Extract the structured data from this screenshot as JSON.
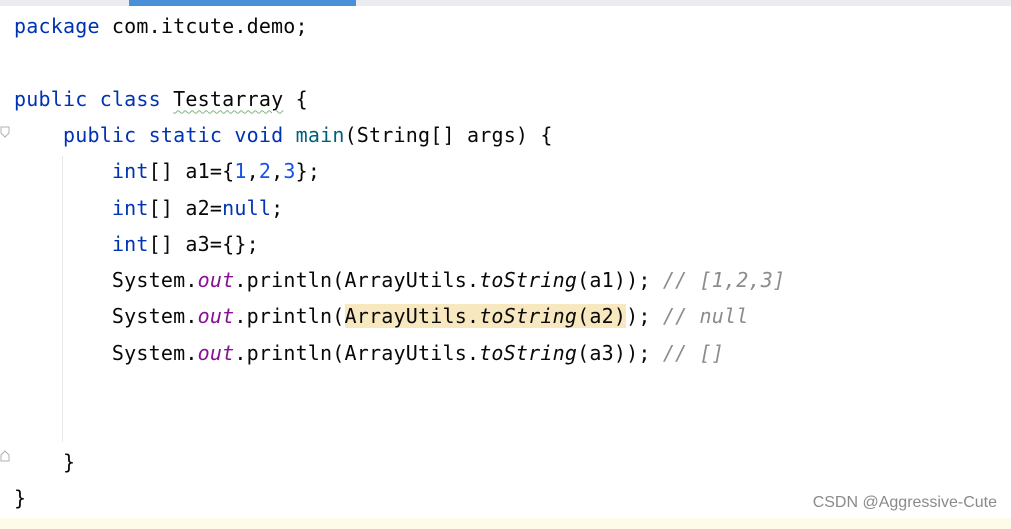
{
  "editor": {
    "lines": [
      {
        "tokens": [
          {
            "t": "package",
            "c": "kw"
          },
          {
            "t": " com.itcute.demo;",
            "c": ""
          }
        ]
      },
      {
        "tokens": []
      },
      {
        "tokens": [
          {
            "t": "public",
            "c": "kw"
          },
          {
            "t": " ",
            "c": ""
          },
          {
            "t": "class",
            "c": "kw"
          },
          {
            "t": " ",
            "c": ""
          },
          {
            "t": "Testarray",
            "c": "typo"
          },
          {
            "t": " {",
            "c": ""
          }
        ]
      },
      {
        "tokens": [
          {
            "t": "    ",
            "c": ""
          },
          {
            "t": "public",
            "c": "kw"
          },
          {
            "t": " ",
            "c": ""
          },
          {
            "t": "static",
            "c": "kw"
          },
          {
            "t": " ",
            "c": ""
          },
          {
            "t": "void",
            "c": "kw"
          },
          {
            "t": " ",
            "c": ""
          },
          {
            "t": "main",
            "c": "mth"
          },
          {
            "t": "(String[] args) {",
            "c": ""
          }
        ]
      },
      {
        "tokens": [
          {
            "t": "        ",
            "c": ""
          },
          {
            "t": "int",
            "c": "kw"
          },
          {
            "t": "[] a1={",
            "c": ""
          },
          {
            "t": "1",
            "c": "num"
          },
          {
            "t": ",",
            "c": ""
          },
          {
            "t": "2",
            "c": "num"
          },
          {
            "t": ",",
            "c": ""
          },
          {
            "t": "3",
            "c": "num"
          },
          {
            "t": "};",
            "c": ""
          }
        ]
      },
      {
        "tokens": [
          {
            "t": "        ",
            "c": ""
          },
          {
            "t": "int",
            "c": "kw"
          },
          {
            "t": "[] a2=",
            "c": ""
          },
          {
            "t": "null",
            "c": "kw"
          },
          {
            "t": ";",
            "c": ""
          }
        ]
      },
      {
        "tokens": [
          {
            "t": "        ",
            "c": ""
          },
          {
            "t": "int",
            "c": "kw"
          },
          {
            "t": "[] a3={};",
            "c": ""
          }
        ]
      },
      {
        "tokens": [
          {
            "t": "        System.",
            "c": ""
          },
          {
            "t": "out",
            "c": "fld"
          },
          {
            "t": ".println(ArrayUtils.",
            "c": ""
          },
          {
            "t": "toString",
            "c": "st"
          },
          {
            "t": "(a1)); ",
            "c": ""
          },
          {
            "t": "// [1,2,3]",
            "c": "cm"
          }
        ]
      },
      {
        "tokens": [
          {
            "t": "        System.",
            "c": ""
          },
          {
            "t": "out",
            "c": "fld"
          },
          {
            "t": ".println(",
            "c": ""
          },
          {
            "t": "ArrayUtils.",
            "c": "hl"
          },
          {
            "t": "toString",
            "c": "hl st"
          },
          {
            "t": "(a2)",
            "c": "hl"
          },
          {
            "t": "); ",
            "c": ""
          },
          {
            "t": "// null",
            "c": "cm"
          }
        ]
      },
      {
        "tokens": [
          {
            "t": "        System.",
            "c": ""
          },
          {
            "t": "out",
            "c": "fld"
          },
          {
            "t": ".println(ArrayUtils.",
            "c": ""
          },
          {
            "t": "toString",
            "c": "st"
          },
          {
            "t": "(a3)); ",
            "c": ""
          },
          {
            "t": "// []",
            "c": "cm"
          }
        ]
      },
      {
        "tokens": []
      },
      {
        "tokens": []
      },
      {
        "tokens": [
          {
            "t": "    }",
            "c": ""
          }
        ]
      },
      {
        "tokens": [
          {
            "t": "}",
            "c": ""
          }
        ]
      }
    ]
  },
  "watermark": "CSDN @Aggressive-Cute",
  "colors": {
    "keyword": "#0033b3",
    "number": "#1750eb",
    "field": "#871094",
    "method": "#00627a",
    "comment": "#8c8c8c",
    "highlight": "#f8e8bf",
    "background": "#ffffff"
  }
}
